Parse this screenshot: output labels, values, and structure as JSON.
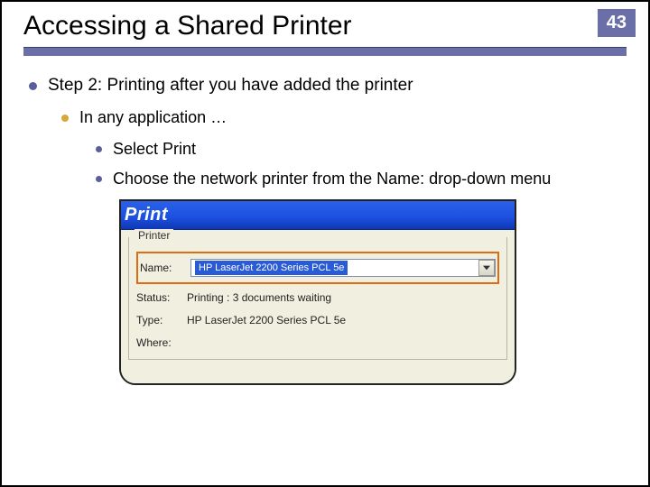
{
  "page_number": "43",
  "title": "Accessing a Shared Printer",
  "bullets": {
    "step": "Step 2: Printing after you have added the printer",
    "sub1": "In any application …",
    "sub2a": "Select Print",
    "sub2b": "Choose the network printer from the Name: drop-down menu"
  },
  "dialog": {
    "title": "Print",
    "group": "Printer",
    "name_label": "Name:",
    "name_value": "HP LaserJet 2200 Series PCL 5e",
    "status_label": "Status:",
    "status_value": "Printing : 3 documents waiting",
    "type_label": "Type:",
    "type_value": "HP LaserJet 2200 Series PCL 5e",
    "where_label": "Where:"
  }
}
